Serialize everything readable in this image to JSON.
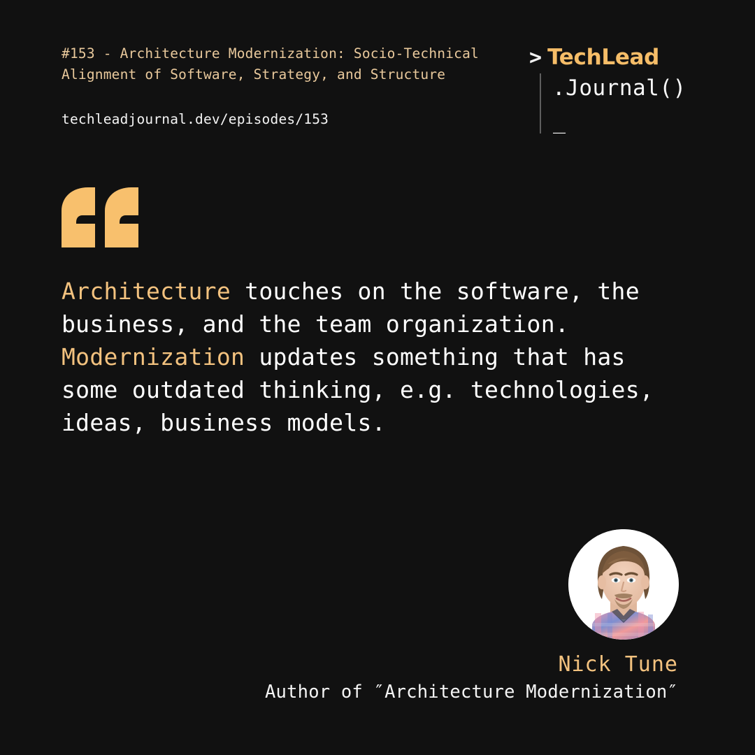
{
  "colors": {
    "background": "#111111",
    "accent_orange": "#f6bd68",
    "accent_tan": "#f3c27f",
    "episode_title": "#e9c99c",
    "text_white": "#ffffff",
    "divider_gray": "#5e5e5e"
  },
  "header": {
    "episode_title": "#153 - Architecture Modernization: Socio-Technical\nAlignment of Software, Strategy, and Structure",
    "episode_number": "#153",
    "url": "techleadjournal.dev/episodes/153"
  },
  "logo": {
    "prompt": ">",
    "brand": "TechLead",
    "suffix": ".Journal()",
    "cursor": "_"
  },
  "quote": {
    "mark": "“",
    "line1_highlight": "Architecture",
    "line1_rest": " touches on the software, the",
    "line2": "business, and the team organization.",
    "line3_highlight": "Modernization",
    "line3_rest": " updates something that has",
    "line4": "some outdated thinking, e.g. technologies,",
    "line5": "ideas, business models.",
    "full_text": "Architecture touches on the software, the business, and the team organization. Modernization updates something that has some outdated thinking, e.g. technologies, ideas, business models."
  },
  "attribution": {
    "name": "Nick Tune",
    "role": "Author of ″Architecture Modernization″",
    "avatar_alt": "guest-headshot"
  }
}
